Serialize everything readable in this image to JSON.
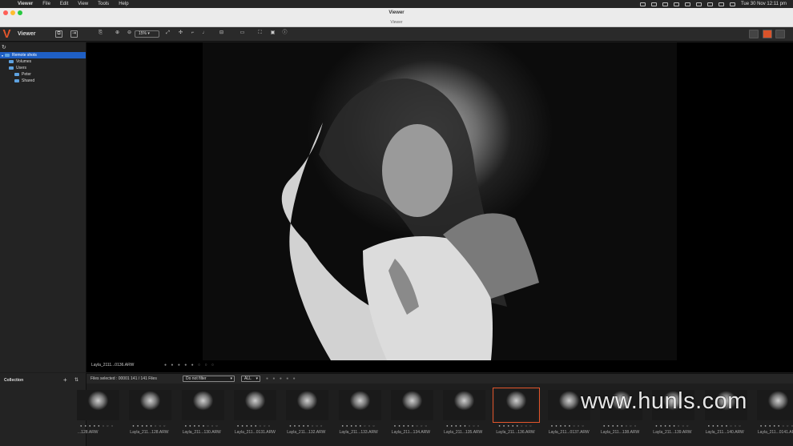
{
  "menubar": {
    "apple": "",
    "items": [
      "Viewer",
      "File",
      "Edit",
      "View",
      "Tools",
      "Help"
    ],
    "clock": "Tue 30 Nov  12:11 pm"
  },
  "window": {
    "title": "Viewer",
    "subtitle": "Viewer"
  },
  "toolbar": {
    "app_name": "Viewer",
    "zoom": "15%",
    "logo": "V"
  },
  "sidebar": {
    "tree": [
      {
        "label": "Remote shots",
        "selected": true,
        "level": 0
      },
      {
        "label": "Volumes",
        "selected": false,
        "level": 1
      },
      {
        "label": "Users",
        "selected": false,
        "level": 1
      },
      {
        "label": "Peter",
        "selected": false,
        "level": 2
      },
      {
        "label": "Shared",
        "selected": false,
        "level": 2
      }
    ]
  },
  "viewer": {
    "filename": "Layla_2111...0136.ARW"
  },
  "collection": {
    "label": "Collection"
  },
  "filmbar": {
    "files_selected": "Files selected : 00001   141 / 141 Files",
    "filter": "Do not filter",
    "rating": "ALL"
  },
  "filmstrip": {
    "thumbs": [
      "...128.ARW",
      "Layla_211...128.ARW",
      "Layla_211...130.ARW",
      "Layla_211...0131.ARW",
      "Layla_211...132.ARW",
      "Layla_211...133.ARW",
      "Layla_211...134.ARW",
      "Layla_211...135.ARW",
      "Layla_211...136.ARW",
      "Layla_211...0137.ARW",
      "Layla_211...138.ARW",
      "Layla_211...139.ARW",
      "Layla_211...140.ARW",
      "Layla_211...0141.ARW"
    ],
    "active_index": 8
  },
  "watermark": "www.hunls.com",
  "colors": {
    "accent": "#e2552b",
    "selection": "#1f5fc4"
  }
}
